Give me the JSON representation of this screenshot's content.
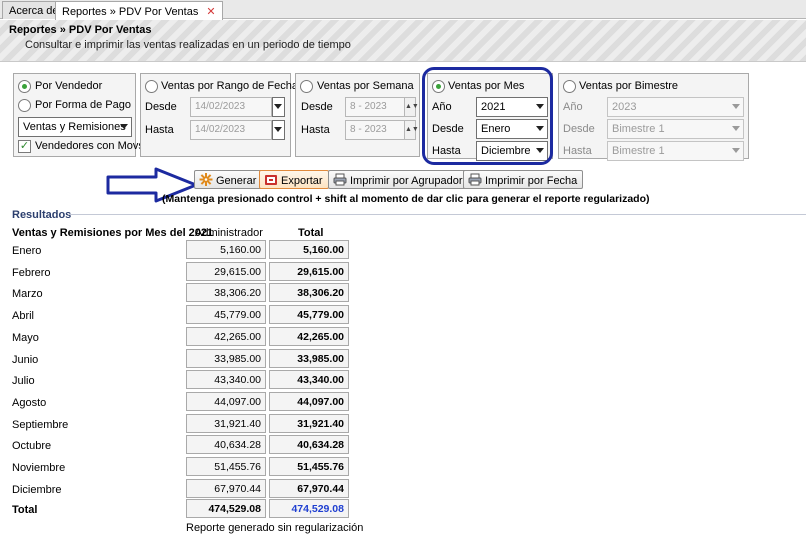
{
  "tabs": [
    {
      "label": "Acerca de"
    },
    {
      "label": "Reportes » PDV Por Ventas",
      "close": "✕"
    }
  ],
  "header": {
    "title": "Reportes » PDV Por Ventas",
    "subtitle": "Consultar e imprimir las ventas realizadas en un periodo de tiempo"
  },
  "grouping": {
    "por_vendedor": "Por Vendedor",
    "por_forma_pago": "Por Forma de Pago",
    "tipo_select": "Ventas y Remisiones",
    "vendedores_con_movs": "Vendedores con Movs"
  },
  "rango_fechas": {
    "title": "Ventas por Rango de Fechas",
    "desde_label": "Desde",
    "desde_value": "14/02/2023",
    "hasta_label": "Hasta",
    "hasta_value": "14/02/2023"
  },
  "semana": {
    "title": "Ventas por Semana",
    "desde_label": "Desde",
    "desde_value": "8 - 2023",
    "hasta_label": "Hasta",
    "hasta_value": "8 - 2023"
  },
  "mes": {
    "title": "Ventas por Mes",
    "anio_label": "Año",
    "anio_value": "2021",
    "desde_label": "Desde",
    "desde_value": "Enero",
    "hasta_label": "Hasta",
    "hasta_value": "Diciembre"
  },
  "bimestre": {
    "title": "Ventas por Bimestre",
    "anio_label": "Año",
    "anio_value": "2023",
    "desde_label": "Desde",
    "desde_value": "Bimestre 1",
    "hasta_label": "Hasta",
    "hasta_value": "Bimestre 1"
  },
  "buttons": {
    "generar": "Generar",
    "exportar": "Exportar",
    "imprimir_agrupador": "Imprimir por Agrupador",
    "imprimir_fecha": "Imprimir por Fecha"
  },
  "note": "(Mantenga presionado control + shift al momento de dar clic para generar el reporte regularizado)",
  "results": {
    "section_title": "Resultados",
    "table_title": "Ventas y Remisiones por Mes del 2021",
    "col_administrador": "Administrador",
    "col_total": "Total",
    "rows": [
      {
        "month": "Enero",
        "admin": "5,160.00",
        "total": "5,160.00"
      },
      {
        "month": "Febrero",
        "admin": "29,615.00",
        "total": "29,615.00"
      },
      {
        "month": "Marzo",
        "admin": "38,306.20",
        "total": "38,306.20"
      },
      {
        "month": "Abril",
        "admin": "45,779.00",
        "total": "45,779.00"
      },
      {
        "month": "Mayo",
        "admin": "42,265.00",
        "total": "42,265.00"
      },
      {
        "month": "Junio",
        "admin": "33,985.00",
        "total": "33,985.00"
      },
      {
        "month": "Julio",
        "admin": "43,340.00",
        "total": "43,340.00"
      },
      {
        "month": "Agosto",
        "admin": "44,097.00",
        "total": "44,097.00"
      },
      {
        "month": "Septiembre",
        "admin": "31,921.40",
        "total": "31,921.40"
      },
      {
        "month": "Octubre",
        "admin": "40,634.28",
        "total": "40,634.28"
      },
      {
        "month": "Noviembre",
        "admin": "51,455.76",
        "total": "51,455.76"
      },
      {
        "month": "Diciembre",
        "admin": "67,970.44",
        "total": "67,970.44"
      }
    ],
    "total_label": "Total",
    "total_admin": "474,529.08",
    "total_total": "474,529.08",
    "footer": "Reporte generado sin regularización"
  },
  "colors": {
    "highlight": "#1c2aa0",
    "total_blue": "#1f3fd1",
    "radio_green": "#3aa23a"
  }
}
